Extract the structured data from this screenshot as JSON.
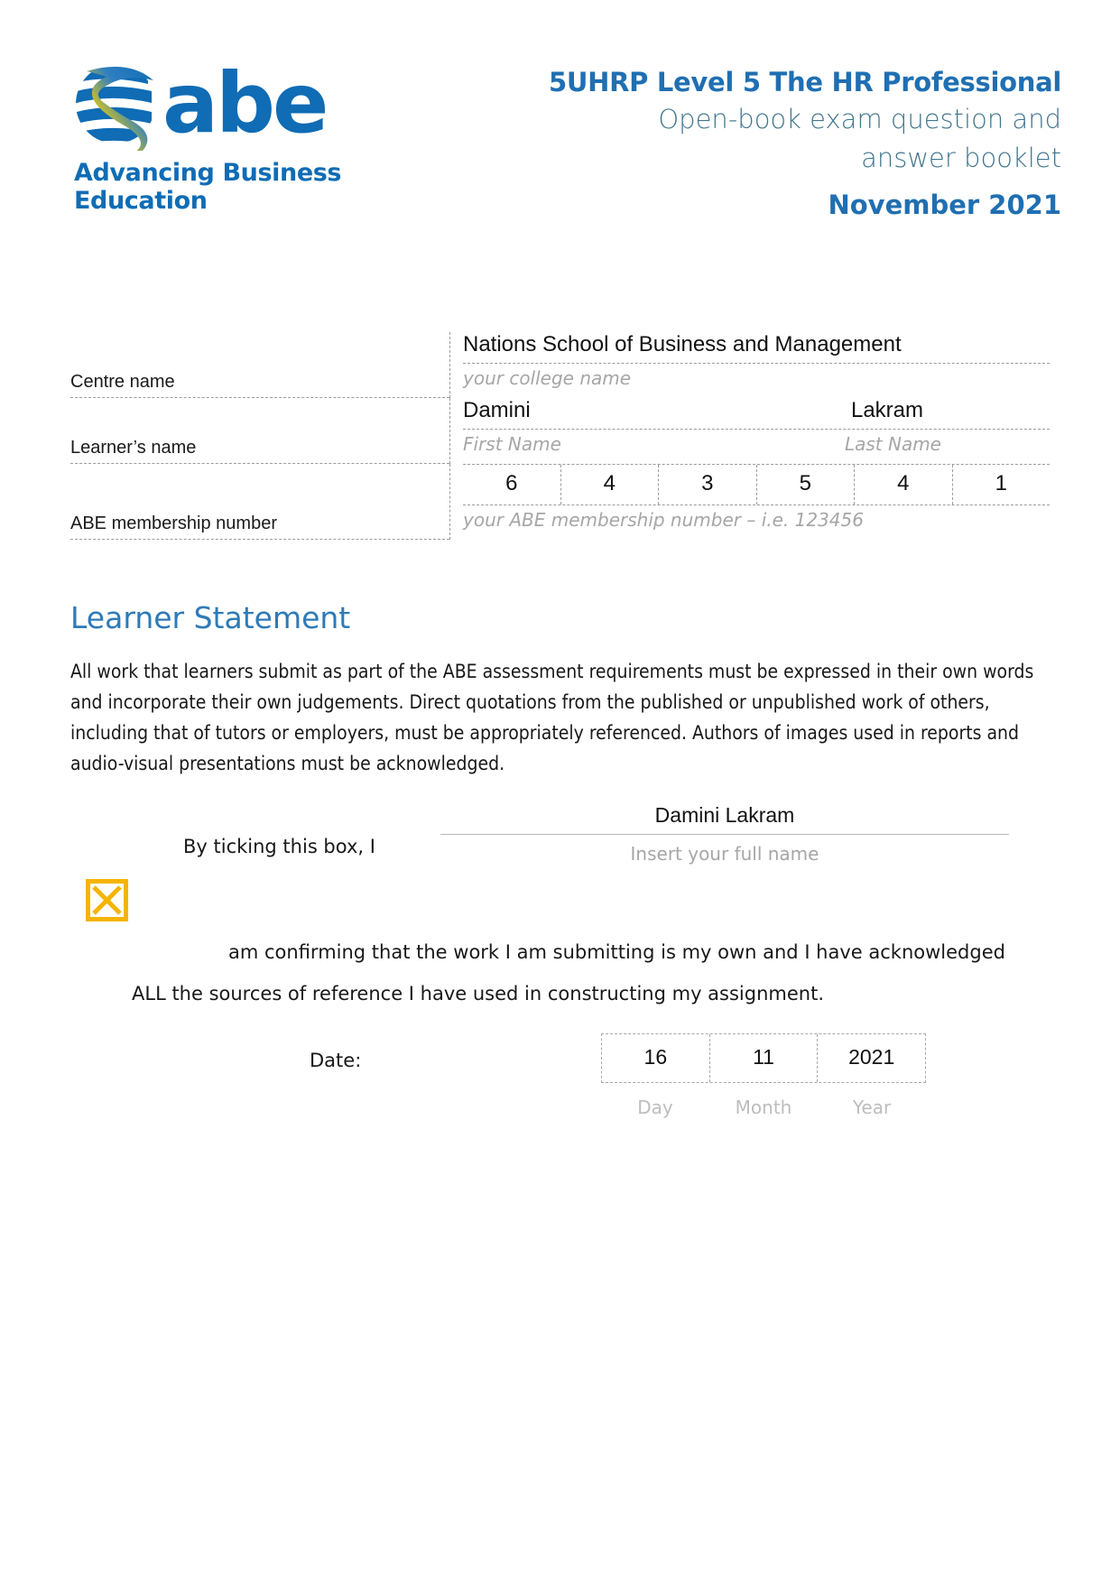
{
  "header": {
    "logo": {
      "wordmark": "abe",
      "tagline": "Advancing Business Education",
      "mark_icon": "abe-globe-swoosh-icon"
    },
    "title": "5UHRP Level 5 The HR Professional",
    "subtitle_line1": "Open-book exam question and",
    "subtitle_line2": "answer booklet",
    "date": "November 2021",
    "colors": {
      "brand_blue": "#0f6cb5",
      "title_blue": "#1f6fb2",
      "subtitle_teal": "#41768e"
    }
  },
  "form": {
    "centre_name": {
      "label": "Centre name",
      "value": "Nations School of Business and Management",
      "hint": "your college name"
    },
    "learner_name": {
      "label": "Learner’s name",
      "first_value": "Damini",
      "last_value": "Lakram",
      "first_hint": "First Name",
      "last_hint": "Last Name"
    },
    "membership": {
      "label": "ABE membership number",
      "digits": [
        "6",
        "4",
        "3",
        "5",
        "4",
        "1"
      ],
      "hint": "your ABE membership number – i.e. 123456"
    }
  },
  "learner_statement": {
    "heading": "Learner Statement",
    "body": "All work that learners submit as part of the ABE assessment requirements must be expressed in their own words and incorporate their own judgements. Direct quotations from the published or unpublished work of others, including that of tutors or employers, must be appropriately referenced. Authors of images used in reports and audio-visual presentations must be acknowledged.",
    "tick_label": "By ticking this box, I",
    "signature_name": "Damini Lakram",
    "signature_caption": "Insert your full name",
    "confirm_line_2": "am confirming that the work I am submitting is my own and I have acknowledged",
    "confirm_line_3": "ALL  the sources of reference I have used in constructing my assignment.",
    "checkbox_state": "checked",
    "checkbox_color": "#f5b400"
  },
  "date": {
    "label": "Date:",
    "day": "16",
    "month": "11",
    "year": "2021",
    "day_caption": "Day",
    "month_caption": "Month",
    "year_caption": "Year"
  }
}
